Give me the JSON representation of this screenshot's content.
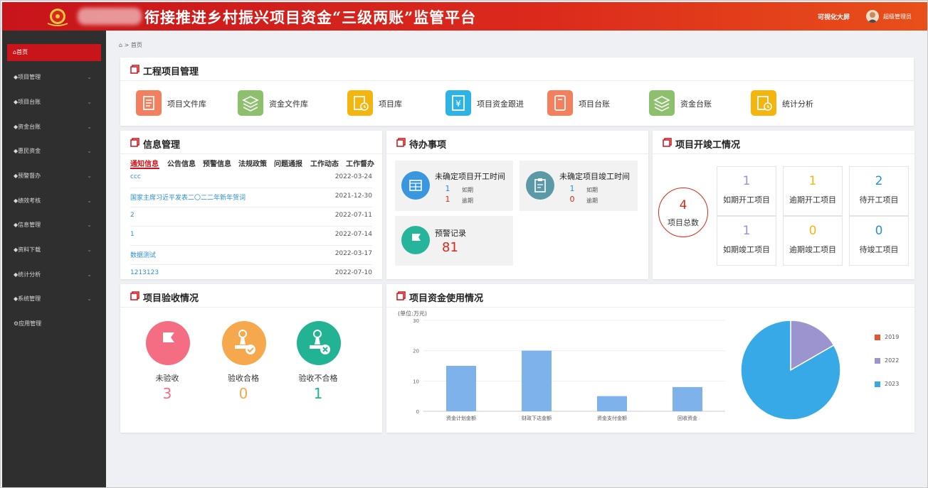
{
  "header": {
    "title": "衔接推进乡村振兴项目资金“三级两账”监管平台",
    "big_screen": "可视化大屏",
    "username": "超级管理员"
  },
  "sidebar": {
    "items": [
      {
        "label": "首页",
        "icon": "home-icon",
        "active": true
      },
      {
        "label": "项目管理",
        "icon": "diamond-icon"
      },
      {
        "label": "项目台账",
        "icon": "diamond-icon"
      },
      {
        "label": "资金台账",
        "icon": "diamond-icon"
      },
      {
        "label": "惠民资金",
        "icon": "diamond-icon"
      },
      {
        "label": "预警督办",
        "icon": "diamond-icon"
      },
      {
        "label": "绩效考核",
        "icon": "diamond-icon"
      },
      {
        "label": "信息管理",
        "icon": "diamond-icon"
      },
      {
        "label": "资料下载",
        "icon": "diamond-icon"
      },
      {
        "label": "统计分析",
        "icon": "diamond-icon"
      },
      {
        "label": "系统管理",
        "icon": "diamond-icon"
      },
      {
        "label": "应用管理",
        "icon": "gear-icon"
      }
    ]
  },
  "breadcrumb": {
    "label": "首页"
  },
  "modules": {
    "title": "工程项目管理",
    "items": [
      {
        "label": "项目文件库",
        "color": "#f47f5e"
      },
      {
        "label": "资金文件库",
        "color": "#8cc06c"
      },
      {
        "label": "项目库",
        "color": "#f5b50f"
      },
      {
        "label": "项目资金跟进",
        "color": "#2eb3e6"
      },
      {
        "label": "项目台账",
        "color": "#f47f5e"
      },
      {
        "label": "资金台账",
        "color": "#8cc06c"
      },
      {
        "label": "统计分析",
        "color": "#f5b50f"
      }
    ]
  },
  "info": {
    "title": "信息管理",
    "tabs": [
      "通知信息",
      "公告信息",
      "预警信息",
      "法规政策",
      "问题通报",
      "工作动态",
      "工作督办"
    ],
    "rows": [
      {
        "title": "ccc",
        "date": "2022-03-24"
      },
      {
        "title": "国家主席习近平发表二〇二二年新年贺词",
        "date": "2021-12-30"
      },
      {
        "title": "2",
        "date": "2022-07-11"
      },
      {
        "title": "1",
        "date": "2022-07-14"
      },
      {
        "title": "数据测试",
        "date": "2022-03-17"
      },
      {
        "title": "1213123",
        "date": "2022-07-10"
      }
    ]
  },
  "todo": {
    "title": "待办事项",
    "start": {
      "label": "未确定项目开工时间",
      "ontime": "1",
      "ontime_label": "如期",
      "overdue": "1",
      "overdue_label": "逾期"
    },
    "end": {
      "label": "未确定项目竣工时间",
      "ontime": "1",
      "ontime_label": "如期",
      "overdue": "0",
      "overdue_label": "逾期"
    },
    "warning": {
      "label": "预警记录",
      "value": "81"
    }
  },
  "status": {
    "title": "项目开竣工情况",
    "total_value": "4",
    "total_label": "项目总数",
    "cells": [
      {
        "value": "1",
        "label": "如期开工项目",
        "color": "#9b8fd4"
      },
      {
        "value": "1",
        "label": "逾期开工项目",
        "color": "#f5b50f"
      },
      {
        "value": "2",
        "label": "待开工项目",
        "color": "#2c8fd1"
      },
      {
        "value": "1",
        "label": "如期竣工项目",
        "color": "#9b8fd4"
      },
      {
        "value": "0",
        "label": "逾期竣工项目",
        "color": "#f5b50f"
      },
      {
        "value": "0",
        "label": "待竣工项目",
        "color": "#2c8fd1"
      }
    ]
  },
  "acceptance": {
    "title": "项目验收情况",
    "items": [
      {
        "label": "未验收",
        "value": "3",
        "color": "#f46d83"
      },
      {
        "label": "验收合格",
        "value": "0",
        "color": "#f5a84c"
      },
      {
        "label": "验收不合格",
        "value": "1",
        "color": "#22b394"
      }
    ]
  },
  "funds": {
    "title": "项目资金使用情况"
  },
  "chart_data": [
    {
      "type": "bar",
      "ylabel": "(单位:万元)",
      "categories": [
        "资金计划金额",
        "财政下达金额",
        "资金支付金额",
        "回收资金"
      ],
      "values": [
        15,
        20,
        5,
        8
      ],
      "ylim": [
        0,
        30
      ],
      "yticks": [
        0,
        10,
        20,
        30
      ],
      "color": "#7db3ea"
    },
    {
      "type": "pie",
      "series": [
        {
          "name": "2019",
          "value": 0,
          "color": "#e4552f"
        },
        {
          "name": "2022",
          "value": 1,
          "color": "#9b94cf"
        },
        {
          "name": "2023",
          "value": 5,
          "color": "#36a9e6"
        }
      ],
      "legend": "right"
    }
  ]
}
